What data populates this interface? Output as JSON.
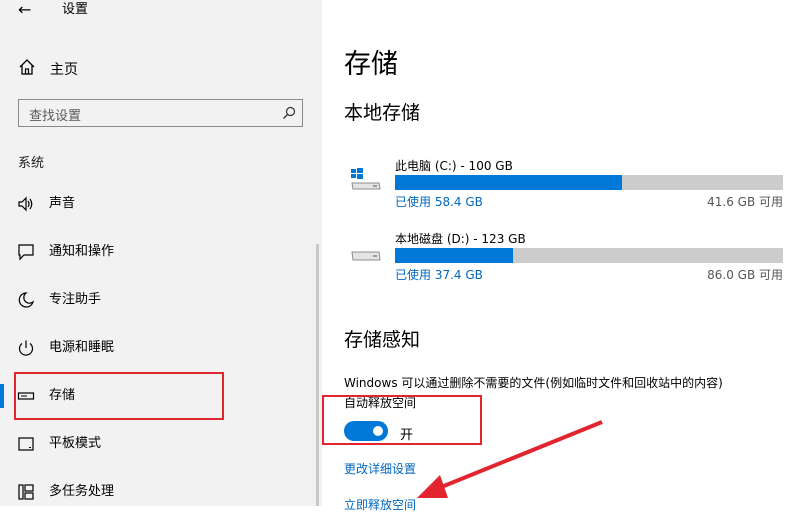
{
  "window": {
    "back_icon": "←",
    "title": "设置"
  },
  "sidebar": {
    "home_label": "主页",
    "search_placeholder": "查找设置",
    "section_label": "系统",
    "items": [
      {
        "label": "声音",
        "icon": "speaker-icon"
      },
      {
        "label": "通知和操作",
        "icon": "notification-icon"
      },
      {
        "label": "专注助手",
        "icon": "moon-icon"
      },
      {
        "label": "电源和睡眠",
        "icon": "power-icon"
      },
      {
        "label": "存储",
        "icon": "storage-icon",
        "active": true
      },
      {
        "label": "平板模式",
        "icon": "tablet-icon"
      },
      {
        "label": "多任务处理",
        "icon": "multitask-icon"
      }
    ]
  },
  "main": {
    "title": "存储",
    "local_storage_heading": "本地存储",
    "drives": [
      {
        "name": "此电脑 (C:) - 100 GB",
        "used": "已使用 58.4 GB",
        "free": "41.6 GB 可用",
        "used_fraction": 0.584
      },
      {
        "name": "本地磁盘 (D:) - 123 GB",
        "used": "已使用 37.4 GB",
        "free": "86.0 GB 可用",
        "used_fraction": 0.304
      }
    ],
    "sense_heading": "存储感知",
    "sense_description": "Windows 可以通过删除不需要的文件(例如临时文件和回收站中的内容)",
    "toggle_label": "自动释放空间",
    "toggle_state": "开",
    "change_settings_link": "更改详细设置",
    "free_now_link": "立即释放空间"
  },
  "colors": {
    "accent": "#0078d7",
    "highlight": "#e2242f"
  }
}
